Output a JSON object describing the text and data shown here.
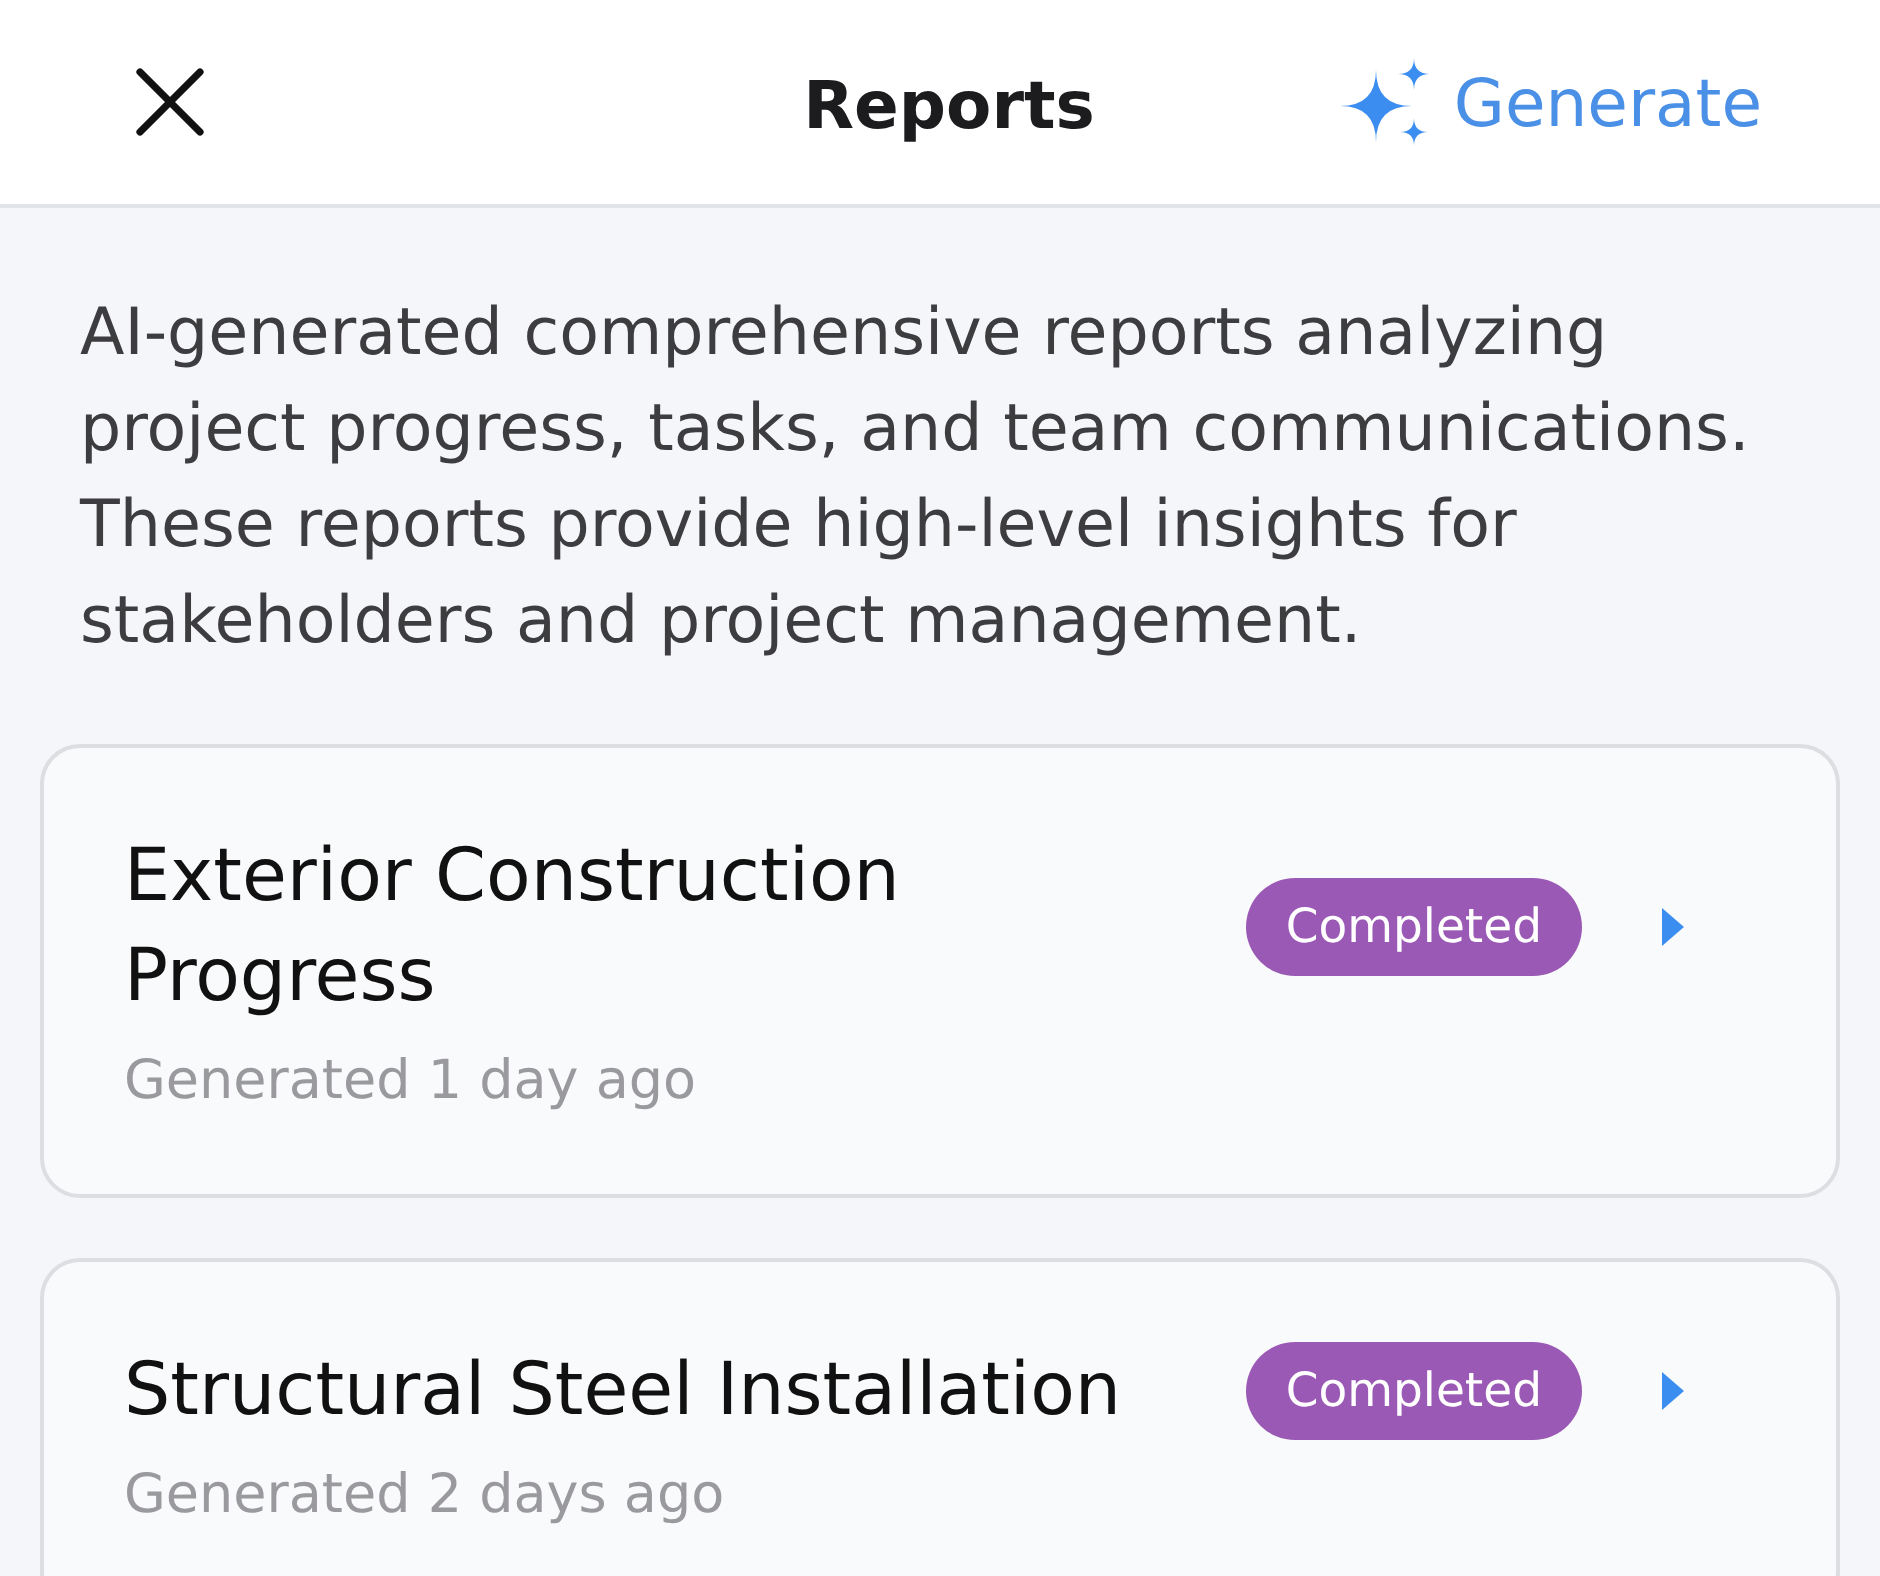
{
  "header": {
    "title": "Reports",
    "action": {
      "label": "Generate"
    }
  },
  "description": "AI-generated comprehensive reports analyzing project progress, tasks, and team communications. These reports provide high-level insights for stakeholders and project management.",
  "reports": [
    {
      "title": "Exterior Construction Progress",
      "generated": "Generated 1 day ago",
      "status": "Completed",
      "color": "#9b59b6"
    },
    {
      "title": "Structural Steel Installation",
      "generated": "Generated 2 days ago",
      "status": "Completed",
      "color": "#9b59b6"
    }
  ]
}
